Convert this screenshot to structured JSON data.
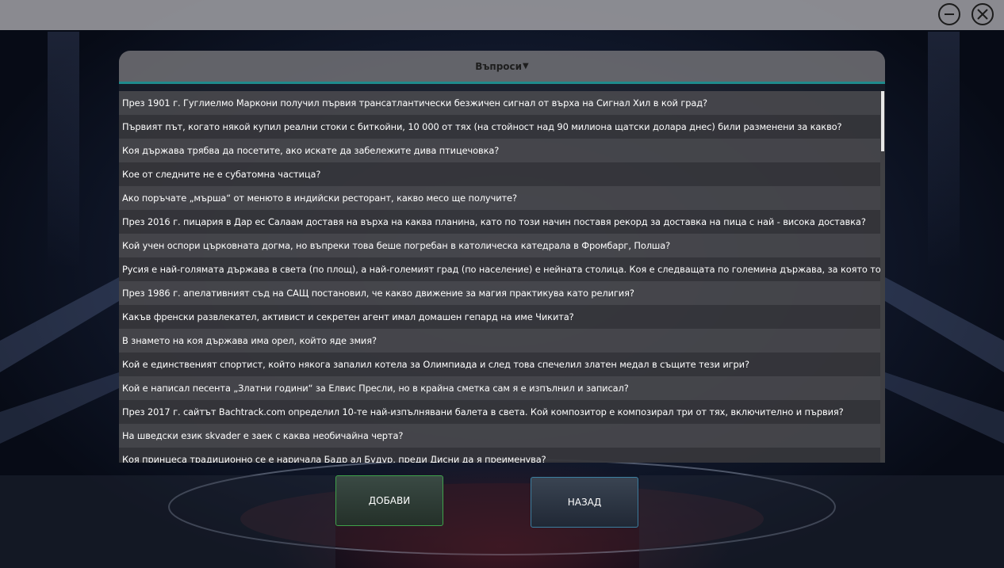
{
  "window": {
    "minimize_icon": "minimize-icon",
    "close_icon": "close-icon"
  },
  "table": {
    "header": "Въпроси",
    "sort_indicator": "▼",
    "rows": [
      "През 1901 г. Гуглиелмо Маркони получил първия трансатлантически безжичен сигнал от върха на Сигнал Хил в кой град?",
      "Първият път, когато някой купил реални стоки с биткойни, 10 000 от тях (на стойност над 90 милиона щатски долара днес) били разменени за какво?",
      "Коя държава трябва да посетите, ако искате да забележите дива птицечовка?",
      "Кое от следните не е субатомна частица?",
      "Ако поръчате „мърша“ от менюто в индийски ресторант, какво месо ще получите?",
      "През 2016 г. пицария в Дар ес Салаам доставя на върха на каква планина, като по този начин поставя рекорд за доставка на пица с най - висока доставка?",
      "Кой учен оспори църковната догма, но въпреки това беше погребан в католическа катедрала в Фромбарг, Полша?",
      "Русия е най-голямата държава в света (по площ), а най-големият град (по население) е нейната столица. Коя е следващата по големина държава, за която това е така?",
      "През 1986 г. апелативният съд на САЩ постановил, че какво движение за магия практикува като религия?",
      "Какъв френски развлекател, активист и секретен агент имал домашен гепард на име Чикита?",
      "В знамето на коя държава има орел, който яде змия?",
      "Кой е единственият спортист, който някога запалил котела за Олимпиада и след това спечелил златен медал в същите тези игри?",
      "Кой е написал песента „Златни години“ за Елвис Пресли, но в крайна сметка сам я е изпълнил и записал?",
      "През 2017 г. сайтът Bachtrack.com определил 10-те най-изпълнявани балета в света. Кой композитор е композирал три от тях, включително и първия?",
      "На шведски език skvader е заек с каква необичайна черта?",
      "Коя принцеса традиционно се е наричала Бадр ал Будур, преди Дисни да я преименува?"
    ]
  },
  "buttons": {
    "add": "ДОБАВИ",
    "back": "НАЗАД"
  },
  "colors": {
    "header_accent": "#1f8a8c",
    "add_border": "#3fa14a",
    "back_border": "#3b7fa0"
  }
}
